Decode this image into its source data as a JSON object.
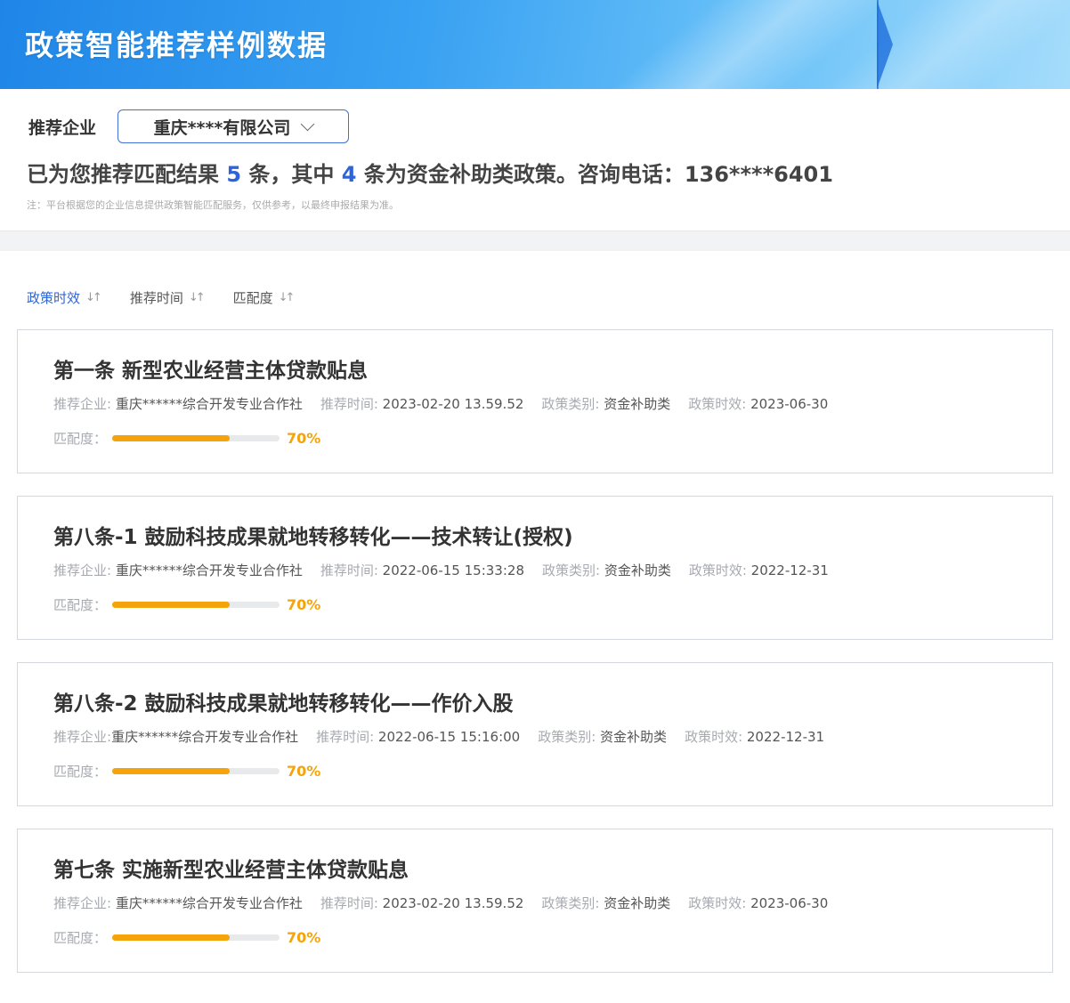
{
  "header": {
    "title": "政策智能推荐样例数据"
  },
  "company": {
    "label": "推荐企业",
    "selected": "重庆****有限公司"
  },
  "summary": {
    "prefix": "已为您推荐匹配结果 ",
    "total": "5",
    "mid": " 条，其中 ",
    "funding_count": "4",
    "suffix": " 条为资金补助类政策。咨询电话：136****6401"
  },
  "note": "注：平台根据您的企业信息提供政策智能匹配服务，仅供参考，以最终申报结果为准。",
  "sort": [
    {
      "label": "政策时效",
      "active": true
    },
    {
      "label": "推荐时间",
      "active": false
    },
    {
      "label": "匹配度",
      "active": false
    }
  ],
  "labels": {
    "company": "推荐企业: ",
    "company_alt": "推荐企业:",
    "time": "推荐时间: ",
    "category": "政策类别: ",
    "validity": "政策时效: ",
    "match": "匹配度："
  },
  "policies": [
    {
      "title": "第一条  新型农业经营主体贷款贴息",
      "company": "重庆******综合开发专业合作社",
      "time": "2023-02-20 13.59.52",
      "category": "资金补助类",
      "validity": "2023-06-30",
      "match": 0.7,
      "match_text": "70%"
    },
    {
      "title": "第八条-1 鼓励科技成果就地转移转化——技术转让(授权)",
      "company": "重庆******综合开发专业合作社",
      "time": "2022-06-15 15:33:28",
      "category": "资金补助类",
      "validity": "2022-12-31",
      "match": 0.7,
      "match_text": "70%"
    },
    {
      "title": "第八条-2 鼓励科技成果就地转移转化——作价入股",
      "company": "重庆******综合开发专业合作社",
      "time": "2022-06-15 15:16:00",
      "category": "资金补助类",
      "validity": "2022-12-31",
      "match": 0.7,
      "match_text": "70%"
    },
    {
      "title": "第七条 实施新型农业经营主体贷款贴息",
      "company": "重庆******综合开发专业合作社",
      "time": "2023-02-20 13.59.52",
      "category": "资金补助类",
      "validity": "2023-06-30",
      "match": 0.7,
      "match_text": "70%"
    }
  ],
  "colors": {
    "accent": "#2f64d8",
    "progress": "#f5a30a"
  }
}
